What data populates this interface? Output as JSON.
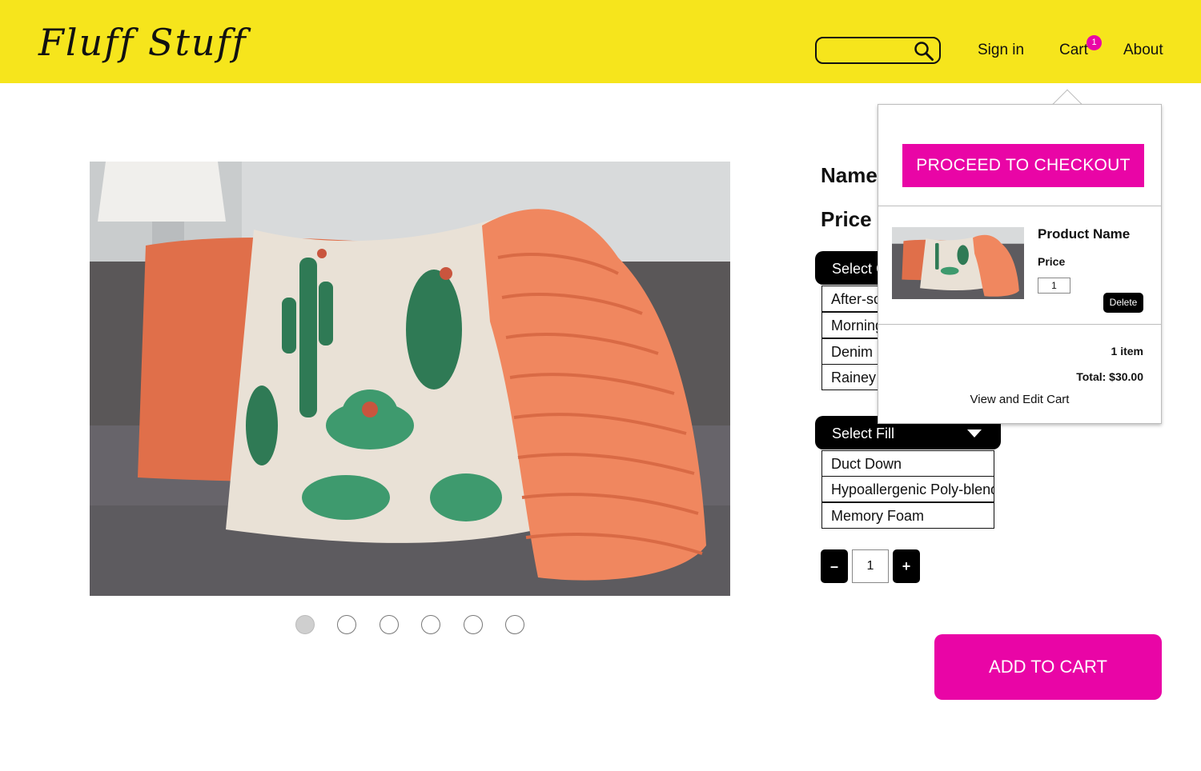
{
  "header": {
    "logo": "Fluff Stuff",
    "search": {
      "value": "",
      "placeholder": ""
    },
    "nav": {
      "sign_in": "Sign in",
      "cart": "Cart",
      "about": "About"
    },
    "cart_badge": "1"
  },
  "product": {
    "name_label": "Name",
    "price_label": "Price",
    "carousel": {
      "total": 6,
      "active": 1
    },
    "color_select": {
      "header": "Select C",
      "options": [
        "After-sc",
        "Morning",
        "Denim",
        "Rainey I"
      ]
    },
    "fill_select": {
      "header": "Select Fill",
      "options": [
        "Duct Down",
        "Hypoallergenic Poly-blend",
        "Memory Foam"
      ]
    },
    "quantity": {
      "minus": "–",
      "value": "1",
      "plus": "+"
    },
    "add_to_cart": "ADD TO CART"
  },
  "cart_popover": {
    "checkout": "PROCEED TO CHECKOUT",
    "item": {
      "name": "Product Name",
      "price": "Price",
      "qty": "1",
      "delete": "Delete"
    },
    "item_count": "1 item",
    "total": "Total: $30.00",
    "view_edit": "View and Edit Cart"
  },
  "colors": {
    "header_bg": "#f6e51c",
    "accent": "#e905a6",
    "dark": "#000000"
  },
  "icons": [
    "search-icon"
  ]
}
